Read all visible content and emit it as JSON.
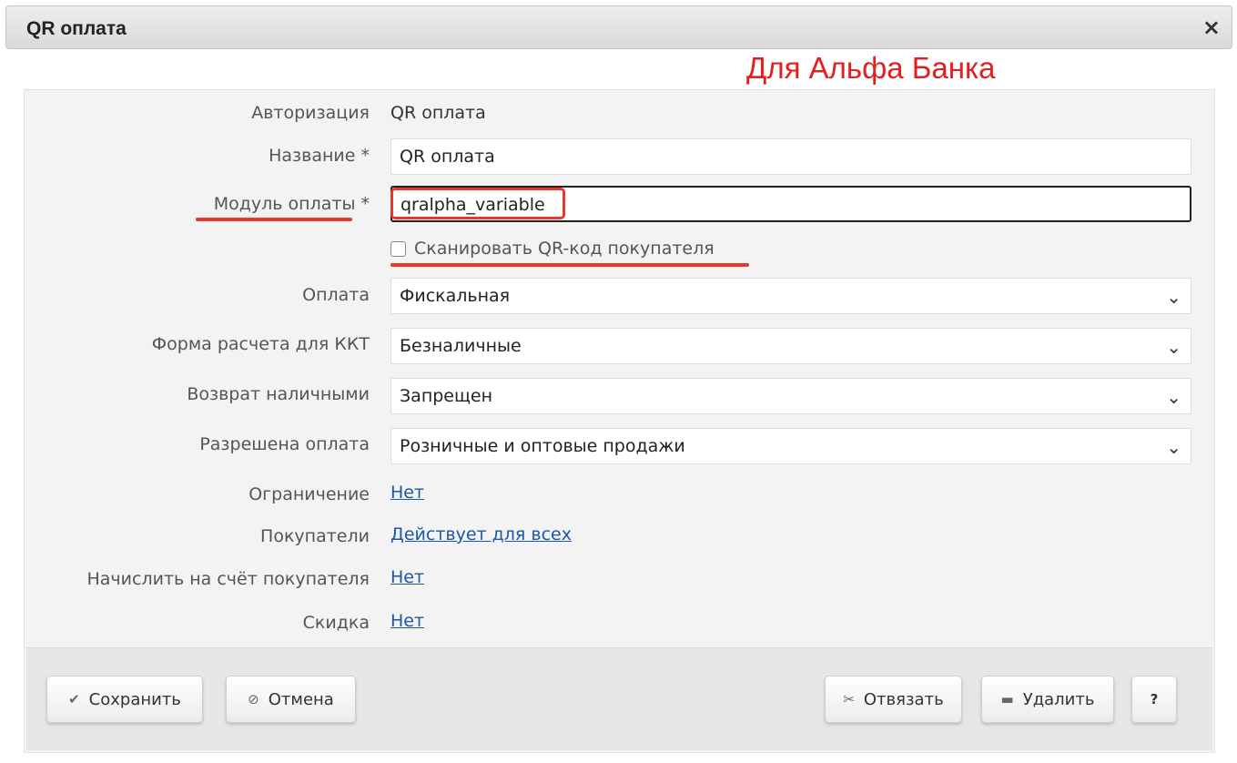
{
  "dialog": {
    "title": "QR оплата",
    "close_glyph": "×"
  },
  "annotation": {
    "text": "Для Альфа Банка",
    "color": "#e2201f"
  },
  "form": {
    "authorization": {
      "label": "Авторизация",
      "value": "QR оплата"
    },
    "name": {
      "label": "Название *",
      "value": "QR оплата"
    },
    "payment_module": {
      "label": "Модуль оплаты *",
      "value": "qralpha_variable"
    },
    "scan_qr": {
      "label": "Сканировать QR-код покупателя",
      "checked": false
    },
    "payment": {
      "label": "Оплата",
      "value": "Фискальная"
    },
    "settlement_form": {
      "label": "Форма расчета для ККТ",
      "value": "Безналичные"
    },
    "cash_refund": {
      "label": "Возврат наличными",
      "value": "Запрещен"
    },
    "allowed_payment": {
      "label": "Разрешена оплата",
      "value": "Розничные и оптовые продажи"
    },
    "restriction": {
      "label": "Ограничение",
      "value": "Нет"
    },
    "customers": {
      "label": "Покупатели",
      "value": "Действует для всех"
    },
    "credit_account": {
      "label": "Начислить на счёт покупателя",
      "value": "Нет"
    },
    "discount": {
      "label": "Скидка",
      "value": "Нет"
    }
  },
  "buttons": {
    "save": {
      "label": "Сохранить",
      "icon": "check-icon"
    },
    "cancel": {
      "label": "Отмена",
      "icon": "cancel-icon"
    },
    "unbind": {
      "label": "Отвязать",
      "icon": "scissors-icon"
    },
    "delete": {
      "label": "Удалить",
      "icon": "minus-icon"
    },
    "help": {
      "label": "?"
    }
  },
  "colors": {
    "highlight": "#e23b2e",
    "link": "#1a59a8"
  }
}
